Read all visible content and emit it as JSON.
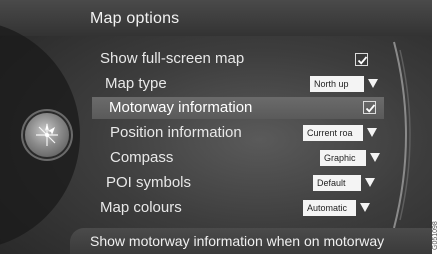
{
  "title": "Map options",
  "items": [
    {
      "label": "Show full-screen map",
      "control": "checkbox",
      "checked": true
    },
    {
      "label": "Map type",
      "control": "select",
      "value": "North up"
    },
    {
      "label": "Motorway information",
      "control": "checkbox",
      "checked": true,
      "selected": true
    },
    {
      "label": "Position information",
      "control": "select",
      "value": "Current roa"
    },
    {
      "label": "Compass",
      "control": "select",
      "value": "Graphic"
    },
    {
      "label": "POI symbols",
      "control": "select",
      "value": "Default"
    },
    {
      "label": "Map colours",
      "control": "select",
      "value": "Automatic"
    }
  ],
  "help_text": "Show motorway information when on motorway",
  "image_code": "G051098",
  "icons": {
    "knob": "navigation-compass-icon",
    "dropdown": "triangle-down-icon",
    "check": "checkmark-icon"
  },
  "colors": {
    "background": "#3d3d3d",
    "selected_row": "#5f5f5f",
    "text": "#e8e8e8",
    "select_bg": "#f4f4f4"
  }
}
